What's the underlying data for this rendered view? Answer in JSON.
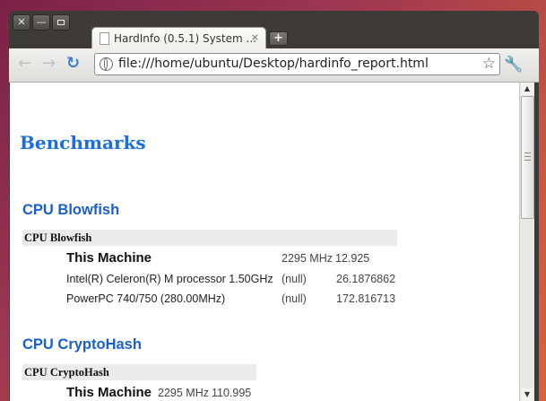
{
  "window": {
    "controls": [
      "close-icon",
      "minimize-icon",
      "maximize-icon"
    ]
  },
  "tab": {
    "title": "HardInfo (0.5.1) System ...",
    "close": "×",
    "new_tab": "+"
  },
  "toolbar": {
    "back": "←",
    "forward": "→",
    "reload": "↻",
    "url": "file:///home/ubuntu/Desktop/hardinfo_report.html",
    "star": "☆",
    "wrench": "🔧"
  },
  "page": {
    "heading": "Benchmarks",
    "sections": [
      {
        "title": "CPU Blowfish",
        "table_header": "CPU Blowfish",
        "rows": [
          {
            "name": "This Machine",
            "freq": "2295 MHz",
            "score": "12.925"
          },
          {
            "name": "Intel(R) Celeron(R) M processor 1.50GHz",
            "freq": "(null)",
            "score": "26.1876862"
          },
          {
            "name": "PowerPC 740/750 (280.00MHz)",
            "freq": "(null)",
            "score": "172.816713"
          }
        ]
      },
      {
        "title": "CPU CryptoHash",
        "table_header": "CPU CryptoHash",
        "rows": [
          {
            "name": "This Machine",
            "freq": "2295 MHz",
            "score": "110.995"
          }
        ]
      }
    ]
  },
  "scrollbar": {
    "up": "▲",
    "down": "▼"
  }
}
